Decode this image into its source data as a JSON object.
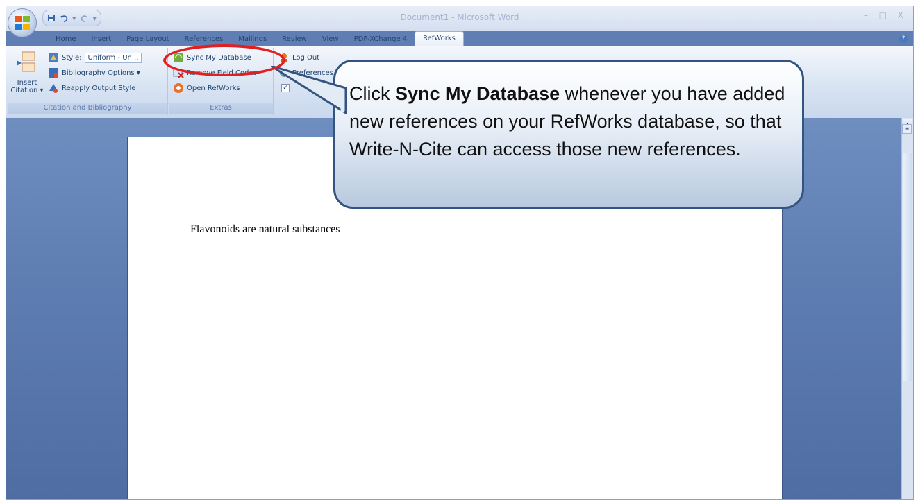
{
  "titlebar": {
    "title": "Document1 - Microsoft Word",
    "window_controls": "– □ X"
  },
  "tabs": [
    {
      "label": "Home"
    },
    {
      "label": "Insert"
    },
    {
      "label": "Page Layout"
    },
    {
      "label": "References"
    },
    {
      "label": "Mailings"
    },
    {
      "label": "Review"
    },
    {
      "label": "View"
    },
    {
      "label": "PDF-XChange 4"
    },
    {
      "label": "RefWorks",
      "active": true
    }
  ],
  "ribbon": {
    "citation_group": {
      "insert_citation_line1": "Insert",
      "insert_citation_line2": "Citation ▾",
      "style_label": "Style:",
      "style_value": "Uniform - Un...",
      "bibliography_options": "Bibliography Options ▾",
      "reapply_output_style": "Reapply Output Style",
      "group_label": "Citation and Bibliography"
    },
    "extras_group": {
      "sync_my_database": "Sync My Database",
      "remove_field_codes": "Remove Field Codes",
      "open_refworks": "Open RefWorks",
      "group_label": "Extras"
    },
    "account_group": {
      "log_out": "Log Out",
      "preferences": "Preferences",
      "checkbox_mark": "✓"
    }
  },
  "document": {
    "body_text": "Flavonoids are natural substances"
  },
  "callout": {
    "prefix": "Click ",
    "bold": "Sync My Database",
    "suffix": " whenever you have added new references on your RefWorks database, so that Write-N-Cite can access those new references."
  },
  "colors": {
    "highlight_oval": "#e02020",
    "callout_border": "#32547e",
    "doc_background": "#5f7fb4"
  }
}
